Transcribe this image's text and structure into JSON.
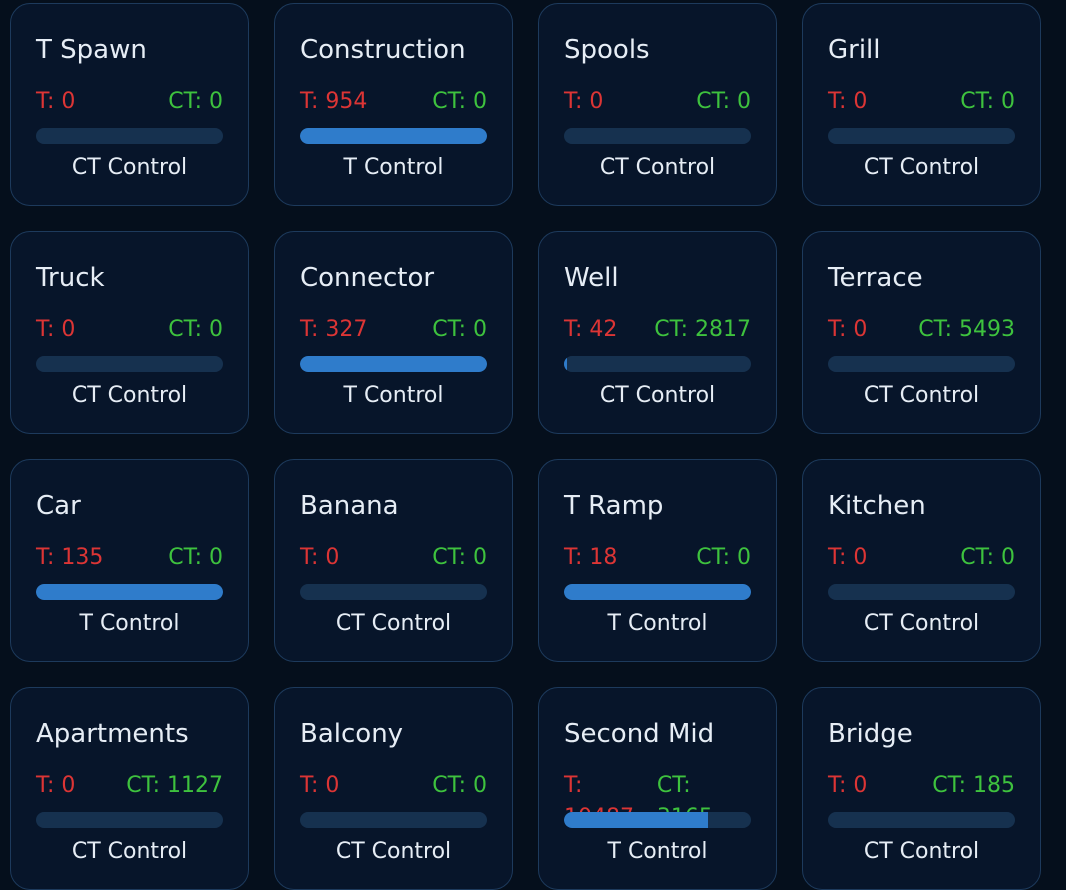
{
  "locations": [
    {
      "name": "T Spawn",
      "t": "T: 0",
      "ct": "CT: 0",
      "t_share": 0,
      "status": "CT Control"
    },
    {
      "name": "Construction",
      "t": "T: 954",
      "ct": "CT: 0",
      "t_share": 1,
      "status": "T Control"
    },
    {
      "name": "Spools",
      "t": "T: 0",
      "ct": "CT: 0",
      "t_share": 0,
      "status": "CT Control"
    },
    {
      "name": "Grill",
      "t": "T: 0",
      "ct": "CT: 0",
      "t_share": 0,
      "status": "CT Control"
    },
    {
      "name": "Truck",
      "t": "T: 0",
      "ct": "CT: 0",
      "t_share": 0,
      "status": "CT Control"
    },
    {
      "name": "Connector",
      "t": "T: 327",
      "ct": "CT: 0",
      "t_share": 1,
      "status": "T Control"
    },
    {
      "name": "Well",
      "t": "T: 42",
      "ct": "CT: 2817",
      "t_share": 0.0147,
      "status": "CT Control"
    },
    {
      "name": "Terrace",
      "t": "T: 0",
      "ct": "CT: 5493",
      "t_share": 0,
      "status": "CT Control"
    },
    {
      "name": "Car",
      "t": "T: 135",
      "ct": "CT: 0",
      "t_share": 1,
      "status": "T Control"
    },
    {
      "name": "Banana",
      "t": "T: 0",
      "ct": "CT: 0",
      "t_share": 0,
      "status": "CT Control"
    },
    {
      "name": "T Ramp",
      "t": "T: 18",
      "ct": "CT: 0",
      "t_share": 1,
      "status": "T Control"
    },
    {
      "name": "Kitchen",
      "t": "T: 0",
      "ct": "CT: 0",
      "t_share": 0,
      "status": "CT Control"
    },
    {
      "name": "Apartments",
      "t": "T: 0",
      "ct": "CT: 1127",
      "t_share": 0,
      "status": "CT Control"
    },
    {
      "name": "Balcony",
      "t": "T: 0",
      "ct": "CT: 0",
      "t_share": 0,
      "status": "CT Control"
    },
    {
      "name": "Second Mid",
      "t": "T: 10487",
      "ct": "CT: 3165",
      "t_share": 0.768,
      "status": "T Control"
    },
    {
      "name": "Bridge",
      "t": "T: 0",
      "ct": "CT: 185",
      "t_share": 0,
      "status": "CT Control"
    }
  ],
  "colors": {
    "t": "#dc3535",
    "ct": "#3ec23e",
    "bar_fill": "#2f7ccb",
    "bar_track": "#16314f"
  }
}
